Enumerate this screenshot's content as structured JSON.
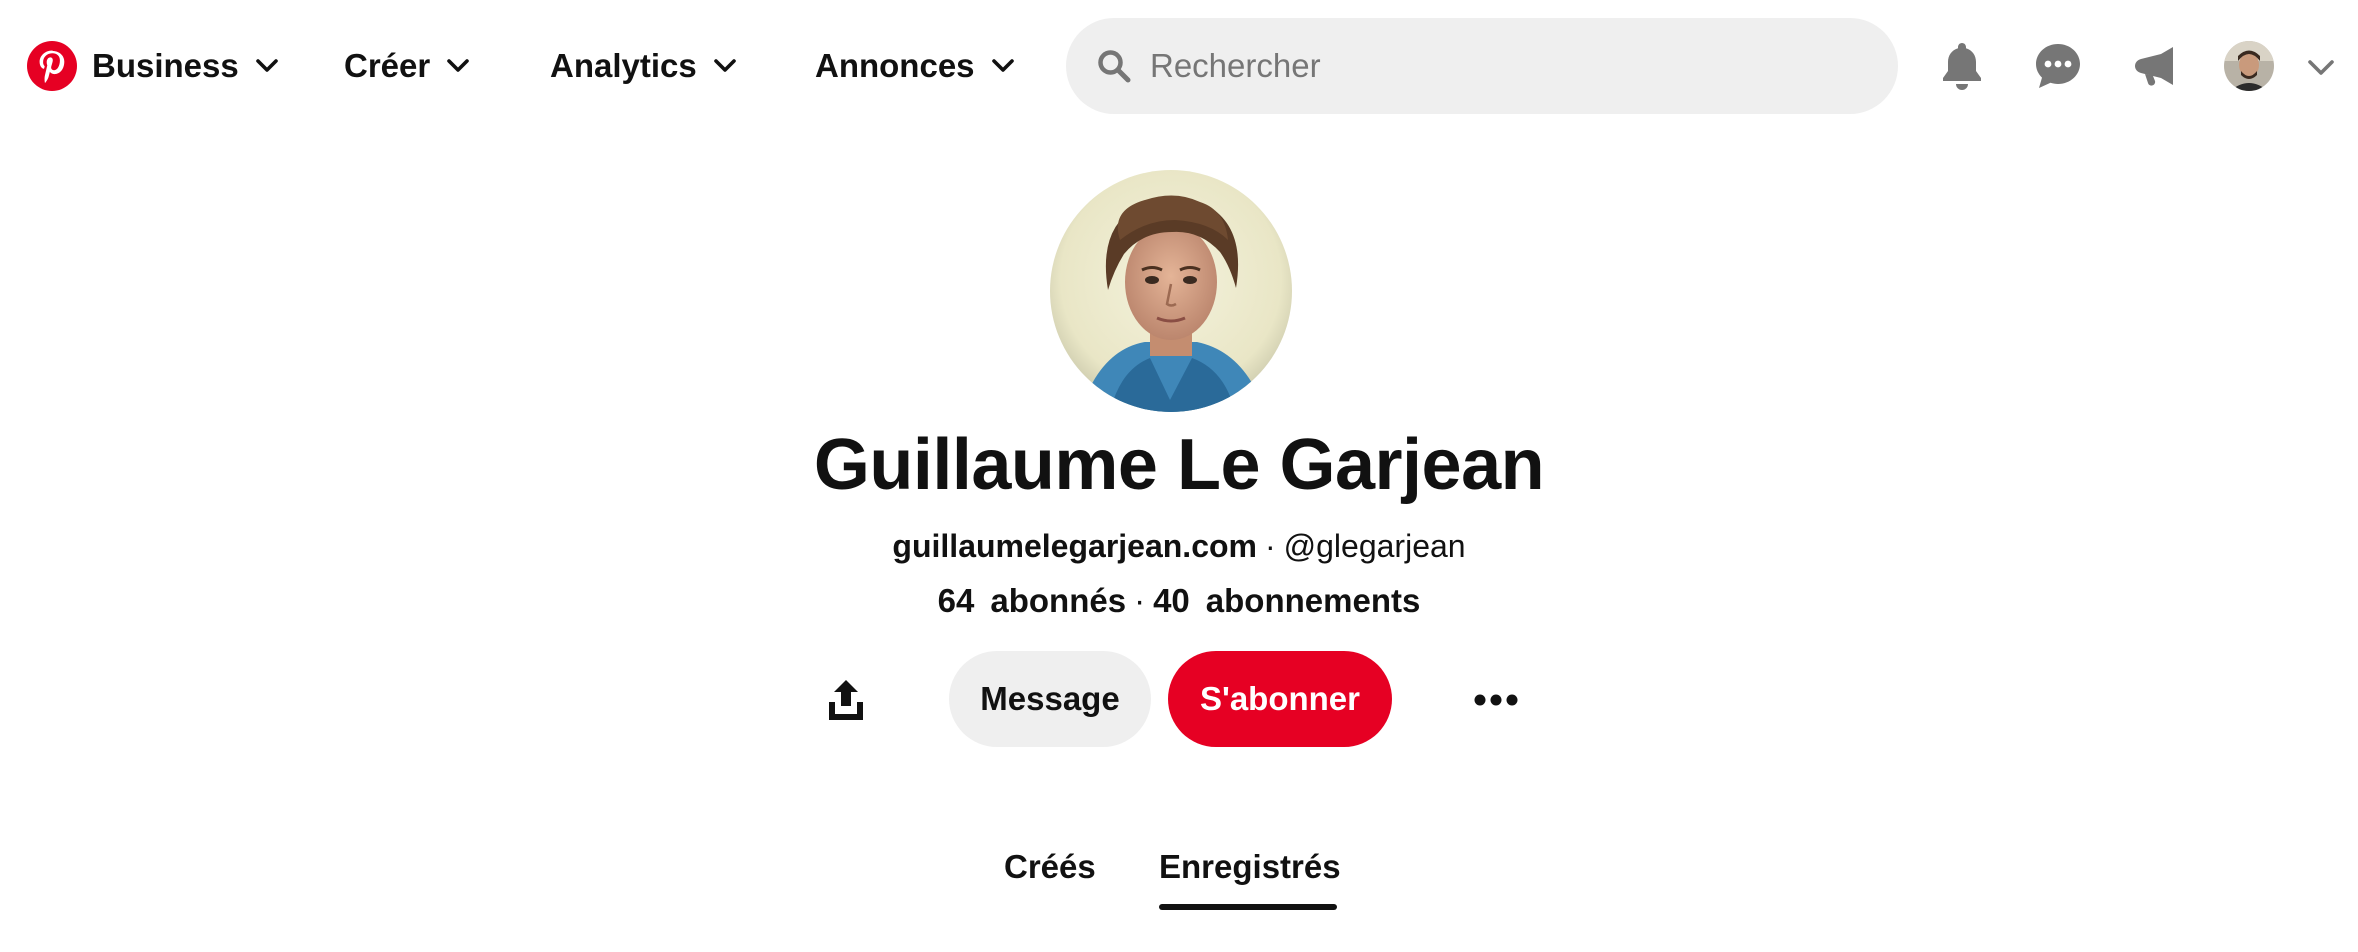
{
  "header": {
    "logo_icon": "pinterest-logo-icon",
    "brand_color": "#e60023",
    "nav": {
      "business_label": "Business",
      "create_label": "Créer",
      "analytics_label": "Analytics",
      "ads_label": "Annonces"
    },
    "search": {
      "placeholder": "Rechercher",
      "value": ""
    },
    "icons": [
      "bell-icon",
      "chat-icon",
      "megaphone-icon",
      "account-avatar",
      "chevron-down-icon"
    ]
  },
  "profile": {
    "name": "Guillaume Le Garjean",
    "website": "guillaumelegarjean.com",
    "separator": "·",
    "handle": "@glegarjean",
    "followers_count": "64",
    "followers_label": "abonnés",
    "following_count": "40",
    "following_label": "abonnements"
  },
  "actions": {
    "message_label": "Message",
    "subscribe_label": "S'abonner",
    "subscribe_color": "#e60023",
    "share_icon": "share-icon",
    "more_icon": "more-options-icon"
  },
  "tabs": {
    "created_label": "Créés",
    "saved_label": "Enregistrés",
    "active": "Enregistrés"
  }
}
